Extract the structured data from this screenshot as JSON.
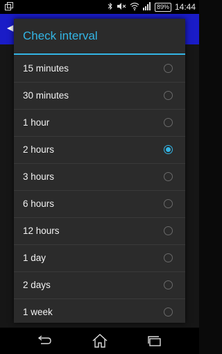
{
  "status_bar": {
    "battery": "89%",
    "time": "14:44",
    "icons": [
      "gallery-icon",
      "bluetooth-icon",
      "mute-icon",
      "wifi-icon",
      "signal-icon",
      "battery-icon"
    ]
  },
  "dialog": {
    "title": "Check interval",
    "options": [
      {
        "label": "15 minutes",
        "checked": false
      },
      {
        "label": "30 minutes",
        "checked": false
      },
      {
        "label": "1 hour",
        "checked": false
      },
      {
        "label": "2 hours",
        "checked": true
      },
      {
        "label": "3 hours",
        "checked": false
      },
      {
        "label": "6 hours",
        "checked": false
      },
      {
        "label": "12 hours",
        "checked": false
      },
      {
        "label": "1 day",
        "checked": false
      },
      {
        "label": "2 days",
        "checked": false
      },
      {
        "label": "1 week",
        "checked": false
      }
    ]
  },
  "nav_bar": {
    "buttons": [
      "back-icon",
      "home-icon",
      "recent-apps-icon"
    ]
  },
  "colors": {
    "accent": "#33b5e5",
    "app_bar": "#1a1cc7",
    "dialog_bg": "#2b2b2b"
  }
}
